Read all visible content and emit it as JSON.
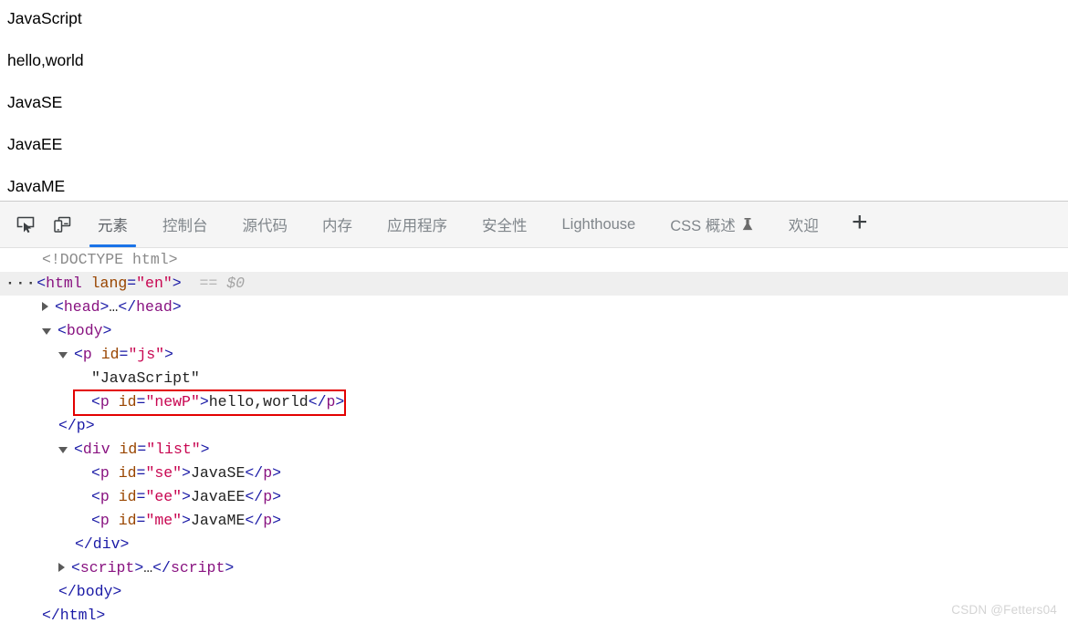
{
  "page_view": {
    "paragraphs": [
      "JavaScript",
      "hello,world",
      "JavaSE",
      "JavaEE",
      "JavaME"
    ]
  },
  "devtools": {
    "icons": {
      "inspect": "inspect-element-icon",
      "device": "device-toolbar-icon",
      "add": "+"
    },
    "tabs": [
      {
        "label": "元素",
        "active": true,
        "icon": ""
      },
      {
        "label": "控制台",
        "active": false,
        "icon": ""
      },
      {
        "label": "源代码",
        "active": false,
        "icon": ""
      },
      {
        "label": "内存",
        "active": false,
        "icon": ""
      },
      {
        "label": "应用程序",
        "active": false,
        "icon": ""
      },
      {
        "label": "安全性",
        "active": false,
        "icon": ""
      },
      {
        "label": "Lighthouse",
        "active": false,
        "icon": ""
      },
      {
        "label": "CSS 概述",
        "active": false,
        "icon": "flask-icon"
      },
      {
        "label": "欢迎",
        "active": false,
        "icon": ""
      }
    ],
    "accent_color": "#1a73e8",
    "tabbar_background": "#f5f5f5"
  },
  "dom_tree": {
    "selected_badge": "== $0",
    "rows": {
      "doctype": "<!DOCTYPE html>",
      "html_open_tag": "html",
      "html_attr_name": "lang",
      "html_attr_value": "\"en\"",
      "head_collapsed": "<head>…</head>",
      "body_tag": "body",
      "p_js_tag": "p",
      "p_js_attr": "id",
      "p_js_value": "\"js\"",
      "js_text": "\"JavaScript\"",
      "newp_tag": "p",
      "newp_attr": "id",
      "newp_value": "\"newP\"",
      "newp_text": "hello,world",
      "p_close": "</p>",
      "div_tag": "div",
      "div_attr": "id",
      "div_value": "\"list\"",
      "p_se_value": "\"se\"",
      "p_se_text": "JavaSE",
      "p_ee_value": "\"ee\"",
      "p_ee_text": "JavaEE",
      "p_me_value": "\"me\"",
      "p_me_text": "JavaME",
      "div_close": "</div>",
      "script_collapsed": "<script>…</script>",
      "body_close": "</body>",
      "html_close": "</html>"
    },
    "highlight_color": "#e30000"
  },
  "watermark": {
    "text": "CSDN @Fetters04"
  }
}
